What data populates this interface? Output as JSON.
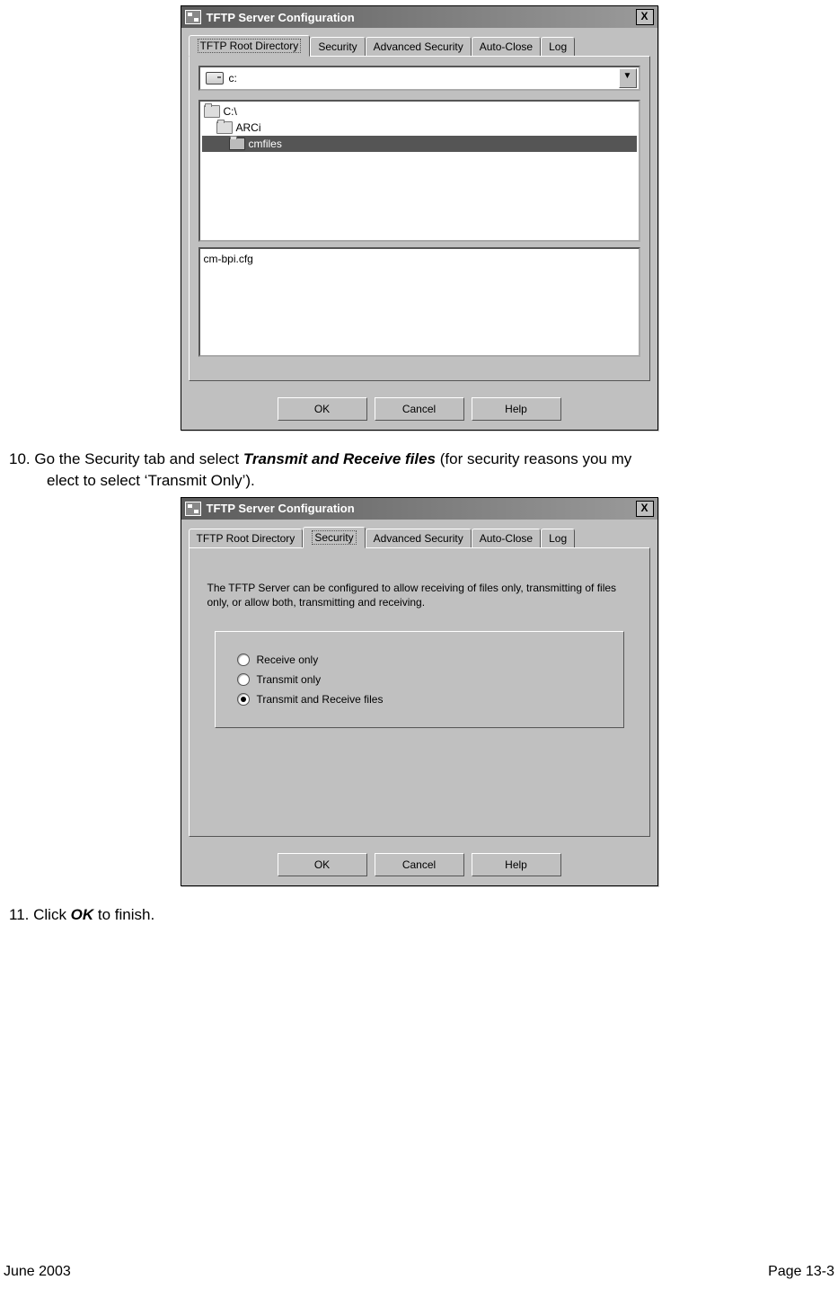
{
  "dialog1": {
    "title": "TFTP Server Configuration",
    "close": "X",
    "tabs": [
      "TFTP Root Directory",
      "Security",
      "Advanced Security",
      "Auto-Close",
      "Log"
    ],
    "activeTab": 0,
    "drive": "c:",
    "tree": [
      {
        "label": "C:\\",
        "indent": 0,
        "sel": false
      },
      {
        "label": "ARCi",
        "indent": 1,
        "sel": false
      },
      {
        "label": "cmfiles",
        "indent": 2,
        "sel": true
      }
    ],
    "file": "cm-bpi.cfg",
    "buttons": {
      "ok": "OK",
      "cancel": "Cancel",
      "help": "Help"
    }
  },
  "step10": {
    "num": "10.",
    "pre": "Go the Security tab and select ",
    "bold": "Transmit and Receive files",
    "post": " (for security reasons you my",
    "line2": "elect to select ‘Transmit Only’)."
  },
  "dialog2": {
    "title": "TFTP Server Configuration",
    "close": "X",
    "tabs": [
      "TFTP Root Directory",
      "Security",
      "Advanced Security",
      "Auto-Close",
      "Log"
    ],
    "activeTab": 1,
    "desc": "The TFTP Server can be configured to allow receiving of files only, transmitting of files only, or allow both, transmitting and receiving.",
    "radios": [
      {
        "label": "Receive only",
        "checked": false
      },
      {
        "label": "Transmit only",
        "checked": false
      },
      {
        "label": "Transmit and Receive files",
        "checked": true
      }
    ],
    "buttons": {
      "ok": "OK",
      "cancel": "Cancel",
      "help": "Help"
    }
  },
  "step11": {
    "num": "11.",
    "pre": "Click ",
    "bold": "OK",
    "post": " to finish."
  },
  "footer": {
    "left": "June 2003",
    "right": "Page 13-3"
  }
}
